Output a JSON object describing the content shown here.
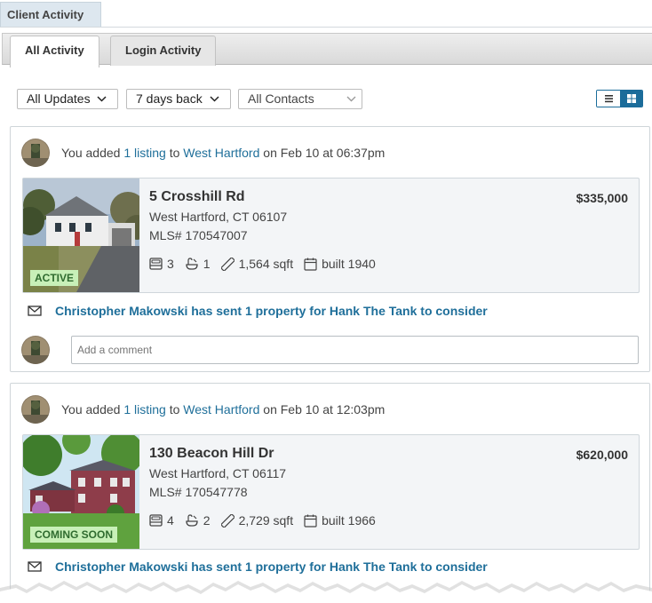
{
  "panel": {
    "title": "Client Activity"
  },
  "tabs": [
    {
      "label": "All Activity",
      "active": true
    },
    {
      "label": "Login Activity",
      "active": false
    }
  ],
  "filters": {
    "updates": "All Updates",
    "days": "7 days back",
    "contacts": "All Contacts"
  },
  "view_toggle": {
    "selected": "grid"
  },
  "activities": [
    {
      "prefix": "You added ",
      "count_link": "1 listing",
      "mid": " to ",
      "area_link": "West Hartford",
      "suffix": " on Feb 10 at 06:37pm",
      "listing": {
        "address": "5 Crosshill Rd",
        "city": "West Hartford, CT 06107",
        "mls": "MLS# 170547007",
        "price": "$335,000",
        "beds": "3",
        "baths": "1",
        "sqft": "1,564 sqft",
        "built": "built 1940",
        "status": "ACTIVE"
      },
      "sent_text": "Christopher Makowski has sent 1 property for Hank The Tank to consider",
      "comment_placeholder": "Add a comment"
    },
    {
      "prefix": "You added ",
      "count_link": "1 listing",
      "mid": " to ",
      "area_link": "West Hartford",
      "suffix": " on Feb 10 at 12:03pm",
      "listing": {
        "address": "130 Beacon Hill Dr",
        "city": "West Hartford, CT 06117",
        "mls": "MLS# 170547778",
        "price": "$620,000",
        "beds": "4",
        "baths": "2",
        "sqft": "2,729 sqft",
        "built": "built 1966",
        "status": "COMING SOON"
      },
      "sent_text": "Christopher Makowski has sent 1 property for Hank The Tank to consider"
    }
  ],
  "colors": {
    "link": "#1f6f9a",
    "accent": "#1b6c9a",
    "active_badge_bg": "#c8f0b8",
    "active_badge_text": "#2f6b2f"
  }
}
